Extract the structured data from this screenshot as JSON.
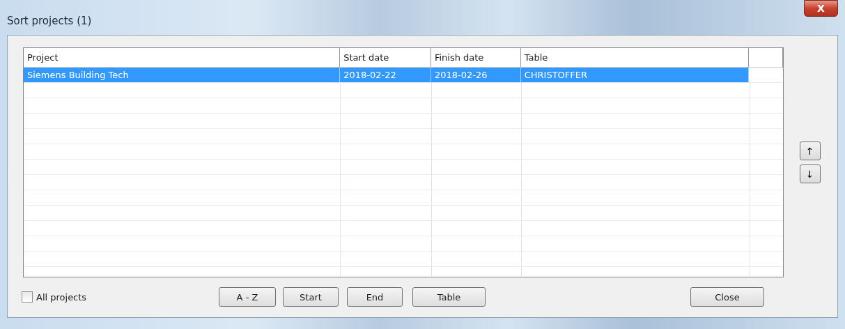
{
  "window": {
    "title": "Sort projects (1)",
    "close": "X"
  },
  "table": {
    "columns": [
      "Project",
      "Start date",
      "Finish date",
      "Table"
    ],
    "rows": [
      {
        "cells": [
          "Siemens Building Tech",
          "2018-02-22",
          "2018-02-26",
          "CHRISTOFFER"
        ],
        "selected": true
      }
    ]
  },
  "move_buttons": [
    "↑",
    "↓"
  ],
  "all_projects": {
    "label": "All projects",
    "checked": false
  },
  "sort_buttons": [
    "A - Z",
    "Start",
    "End",
    "Table"
  ],
  "close_button": "Close"
}
